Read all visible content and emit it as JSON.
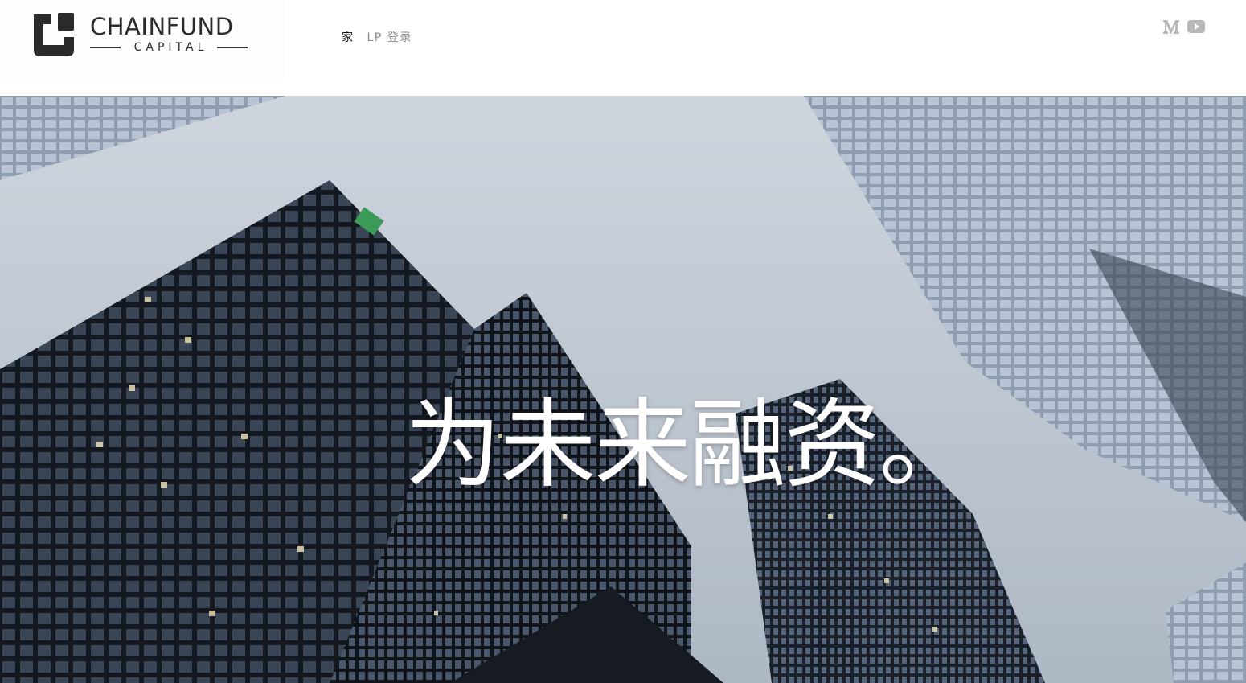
{
  "brand": {
    "name": "CHAINFUND",
    "subtitle": "CAPITAL"
  },
  "nav": {
    "items": [
      {
        "label": "家",
        "active": true
      },
      {
        "label": "LP 登录",
        "active": false
      }
    ]
  },
  "social": {
    "icons": [
      "medium-icon",
      "youtube-icon"
    ],
    "color": "#b8b8b8"
  },
  "hero": {
    "title": "为未来融资。"
  },
  "colors": {
    "brand_dark": "#2b2b2b",
    "nav_active": "#111111",
    "nav_inactive": "#8a8a8a"
  }
}
